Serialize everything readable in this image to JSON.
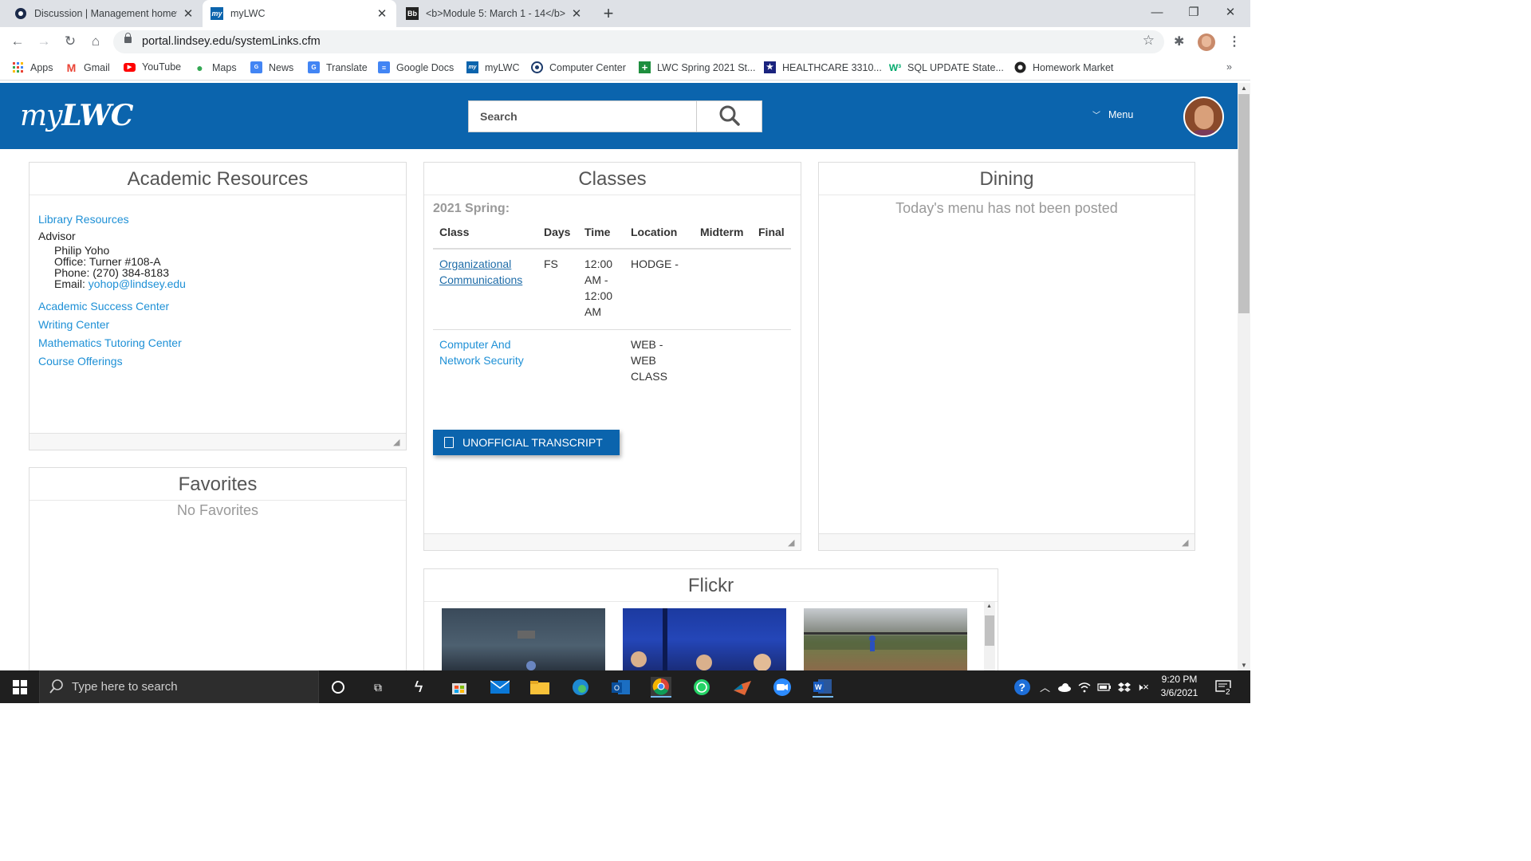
{
  "browser": {
    "tabs": [
      {
        "title": "Discussion | Management homew",
        "favicon": "circle-logo-icon",
        "active": false
      },
      {
        "title": "myLWC",
        "favicon": "mylwc-icon",
        "active": true
      },
      {
        "title": "<b>Module 5: March 1 - 14</b>",
        "favicon": "bb-icon",
        "favicon_text": "Bb",
        "active": false
      }
    ],
    "url": "portal.lindsey.edu/systemLinks.cfm",
    "bookmarks": [
      {
        "label": "Apps",
        "icon": "apps-grid-icon"
      },
      {
        "label": "Gmail",
        "icon": "gmail-icon"
      },
      {
        "label": "YouTube",
        "icon": "youtube-icon"
      },
      {
        "label": "Maps",
        "icon": "maps-icon"
      },
      {
        "label": "News",
        "icon": "news-icon"
      },
      {
        "label": "Translate",
        "icon": "translate-icon"
      },
      {
        "label": "Google Docs",
        "icon": "docs-icon"
      },
      {
        "label": "myLWC",
        "icon": "mylwc-icon"
      },
      {
        "label": "Computer Center",
        "icon": "computer-center-icon"
      },
      {
        "label": "LWC Spring 2021 St...",
        "icon": "plus-icon"
      },
      {
        "label": "HEALTHCARE 3310...",
        "icon": "star-badge-icon"
      },
      {
        "label": "SQL UPDATE State...",
        "icon": "w3-icon"
      },
      {
        "label": "Homework Market",
        "icon": "circle-logo-icon"
      }
    ],
    "more_label": "»"
  },
  "header": {
    "logo_my": "my",
    "logo_lwc": "LWC",
    "search_placeholder": "Search",
    "menu_label": "Menu"
  },
  "academic": {
    "title": "Academic Resources",
    "library": "Library Resources",
    "advisor_label": "Advisor",
    "advisor_name": "Philip Yoho",
    "office": "Office: Turner #108-A",
    "phone": "Phone: (270) 384-8183",
    "email_label": "Email:",
    "email": "yohop@lindsey.edu",
    "links": [
      "Academic Success Center",
      "Writing Center",
      "Mathematics Tutoring Center",
      "Course Offerings"
    ]
  },
  "favorites": {
    "title": "Favorites",
    "empty": "No Favorites"
  },
  "classes": {
    "title": "Classes",
    "semester": "2021 Spring:",
    "headers": [
      "Class",
      "Days",
      "Time",
      "Location",
      "Midterm",
      "Final"
    ],
    "rows": [
      {
        "class": "Organizational Communications",
        "days": "FS",
        "time": "12:00 AM - 12:00 AM",
        "location": "HODGE -",
        "midterm": "",
        "final": ""
      },
      {
        "class": "Computer And Network Security",
        "days": "",
        "time": "",
        "location": "WEB - WEB CLASS",
        "midterm": "",
        "final": ""
      }
    ],
    "transcript_button": "UNOFFICIAL TRANSCRIPT"
  },
  "dining": {
    "title": "Dining",
    "message": "Today's menu has not been posted"
  },
  "flickr": {
    "title": "Flickr"
  },
  "taskbar": {
    "search_placeholder": "Type here to search",
    "time": "9:20 PM",
    "date": "3/6/2021",
    "notification_count": "2"
  }
}
